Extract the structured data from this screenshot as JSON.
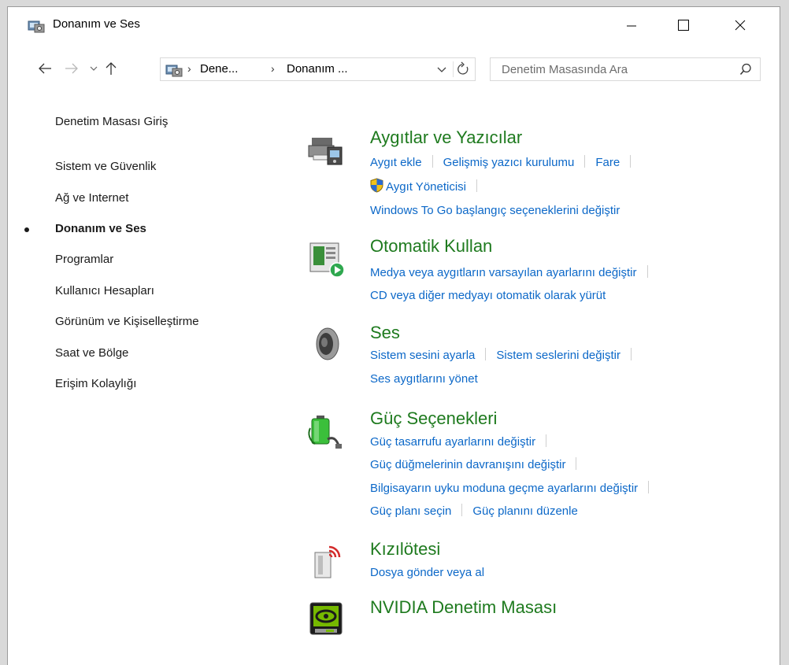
{
  "window": {
    "title": "Donanım ve Ses"
  },
  "address": {
    "crumbs": [
      "Dene...",
      "Donanım ..."
    ],
    "separator": "›"
  },
  "search": {
    "placeholder": "Denetim Masasında Ara"
  },
  "sidebar": {
    "home": "Denetim Masası Giriş",
    "items": [
      {
        "label": "Sistem ve Güvenlik"
      },
      {
        "label": "Ağ ve Internet"
      },
      {
        "label": "Donanım ve Ses",
        "active": true
      },
      {
        "label": "Programlar"
      },
      {
        "label": "Kullanıcı Hesapları"
      },
      {
        "label": "Görünüm ve Kişiselleştirme"
      },
      {
        "label": "Saat ve Bölge"
      },
      {
        "label": "Erişim Kolaylığı"
      }
    ]
  },
  "categories": {
    "devices": {
      "title": "Aygıtlar ve Yazıcılar",
      "links": [
        "Aygıt ekle",
        "Gelişmiş yazıcı kurulumu",
        "Fare",
        "Aygıt Yöneticisi",
        "Windows To Go başlangıç seçeneklerini değiştir"
      ]
    },
    "autoplay": {
      "title": "Otomatik Kullan",
      "links": [
        "Medya veya aygıtların varsayılan ayarlarını değiştir",
        "CD veya diğer medyayı otomatik olarak yürüt"
      ]
    },
    "sound": {
      "title": "Ses",
      "links": [
        "Sistem sesini ayarla",
        "Sistem seslerini değiştir",
        "Ses aygıtlarını yönet"
      ]
    },
    "power": {
      "title": "Güç Seçenekleri",
      "links": [
        "Güç tasarrufu ayarlarını değiştir",
        "Güç düğmelerinin davranışını değiştir",
        "Bilgisayarın uyku moduna geçme ayarlarını değiştir",
        "Güç planı seçin",
        "Güç planını düzenle"
      ]
    },
    "infrared": {
      "title": "Kızılötesi",
      "links": [
        "Dosya gönder veya al"
      ]
    },
    "nvidia": {
      "title": "NVIDIA Denetim Masası"
    }
  },
  "colors": {
    "link": "#0c68c8",
    "category_title": "#1e7a1e"
  },
  "icons": {
    "app": "control-panel-icon",
    "back": "back-arrow-icon",
    "forward": "forward-arrow-icon",
    "recent": "chevron-down-icon",
    "up": "up-arrow-icon",
    "refresh": "refresh-icon",
    "search": "search-icon"
  }
}
